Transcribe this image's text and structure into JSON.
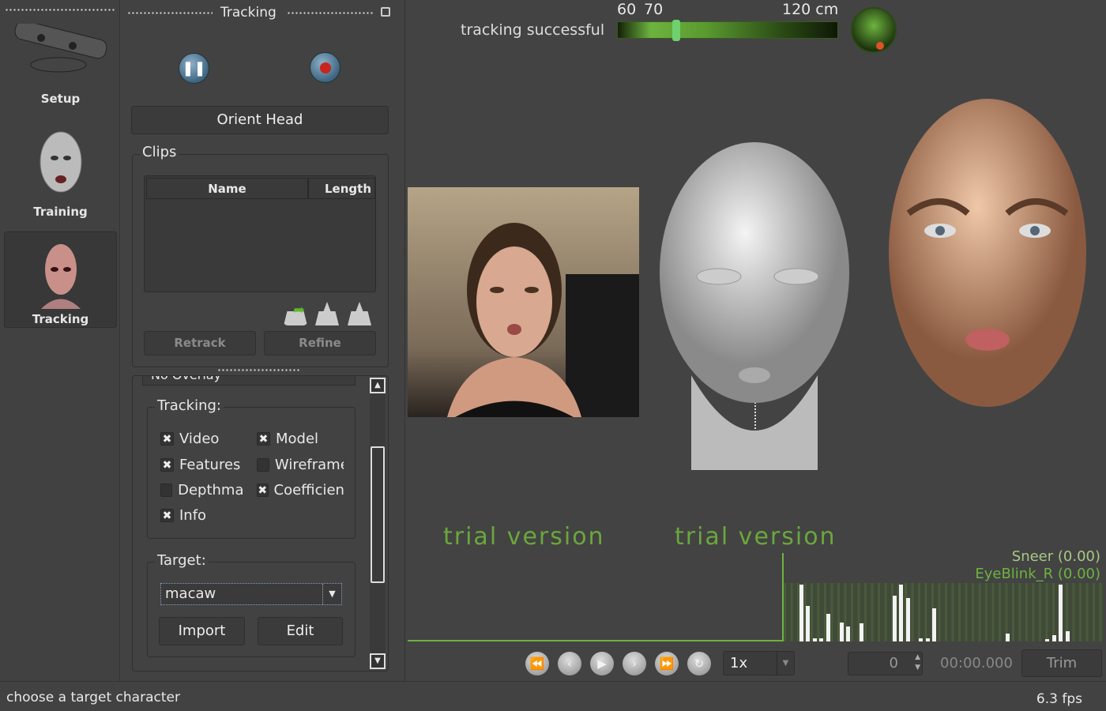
{
  "sidebar": {
    "items": [
      {
        "label": "Setup",
        "icon": "depth-camera-icon"
      },
      {
        "label": "Training",
        "icon": "mesh-head-icon"
      },
      {
        "label": "Tracking",
        "icon": "alien-head-icon",
        "selected": true
      }
    ]
  },
  "panel": {
    "title": "Tracking",
    "orient_head": "Orient Head",
    "clips": {
      "label": "Clips",
      "columns": [
        "Name",
        "Length"
      ],
      "rows": [],
      "retrack": "Retrack",
      "refine": "Refine"
    },
    "overlay_select": "No Overlay",
    "tracking": {
      "label": "Tracking:",
      "options": [
        {
          "label": "Video",
          "checked": true
        },
        {
          "label": "Model",
          "checked": true
        },
        {
          "label": "Features",
          "checked": true
        },
        {
          "label": "Wireframe",
          "checked": false
        },
        {
          "label": "Depthmap",
          "checked": false
        },
        {
          "label": "Coefficients",
          "checked": true
        },
        {
          "label": "Info",
          "checked": true
        }
      ]
    },
    "target": {
      "label": "Target:",
      "value": "macaw",
      "import": "Import",
      "edit": "Edit"
    }
  },
  "header": {
    "status": "tracking successful",
    "distance_labels": [
      "60",
      "70",
      "120 cm"
    ],
    "distance_cm": 70,
    "accent": "#6db33f"
  },
  "viewport": {
    "watermarks": [
      "trial version",
      "trial version"
    ]
  },
  "coefficients": {
    "labels": [
      "Sneer (0.00)",
      "EyeBlink_R (0.00)"
    ],
    "levels": [
      1.0,
      0.63,
      0.05,
      0.05,
      0.49,
      0.33,
      0.27,
      0.32,
      0.8,
      1.0,
      0.76,
      0.05,
      0.05,
      0.59,
      0.14,
      0.04,
      0.11,
      1.0,
      0.18
    ]
  },
  "transport": {
    "speed": "1x",
    "frame": "0",
    "time": "00:00.000",
    "trim": "Trim"
  },
  "status": {
    "message": "choose a target character",
    "fps": "6.3 fps"
  }
}
